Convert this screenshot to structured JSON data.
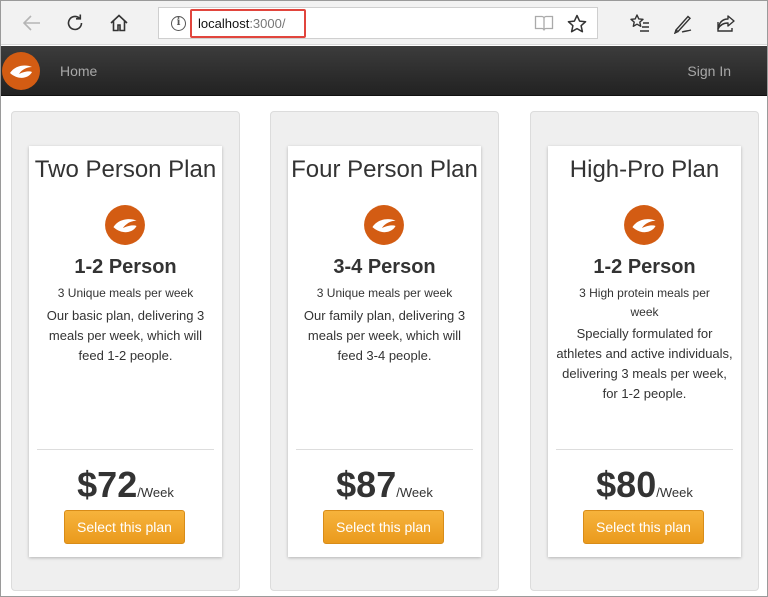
{
  "browser": {
    "url_host": "localhost",
    "url_port": ":3000/",
    "info_glyph": "i",
    "icons": [
      "back-arrow-icon",
      "refresh-icon",
      "home-icon",
      "reading-view-icon",
      "favorite-star-icon",
      "favorites-list-icon",
      "pen-icon",
      "share-icon"
    ]
  },
  "navbar": {
    "home_label": "Home",
    "signin_label": "Sign In",
    "brand_color": "#d35c13"
  },
  "plans": [
    {
      "title": "Two Person Plan",
      "people": "1-2 Person",
      "meals": "3 Unique meals per week",
      "description": "Our basic plan, delivering 3 meals per week, which will feed 1-2 people.",
      "price": "$72",
      "unit": "/Week",
      "button_label": "Select this plan"
    },
    {
      "title": "Four Person Plan",
      "people": "3-4 Person",
      "meals": "3 Unique meals per week",
      "description": "Our family plan, delivering 3 meals per week, which will feed 3-4 people.",
      "price": "$87",
      "unit": "/Week",
      "button_label": "Select this plan"
    },
    {
      "title": "High-Pro Plan",
      "people": "1-2 Person",
      "meals": "3 High protein meals per week",
      "description": "Specially formulated for athletes and active individuals, delivering 3 meals per week, for 1-2 people.",
      "price": "$80",
      "unit": "/Week",
      "button_label": "Select this plan"
    }
  ],
  "colors": {
    "accent": "#d35c13",
    "button": "#f0a42b",
    "url_highlight": "#e1453d"
  }
}
